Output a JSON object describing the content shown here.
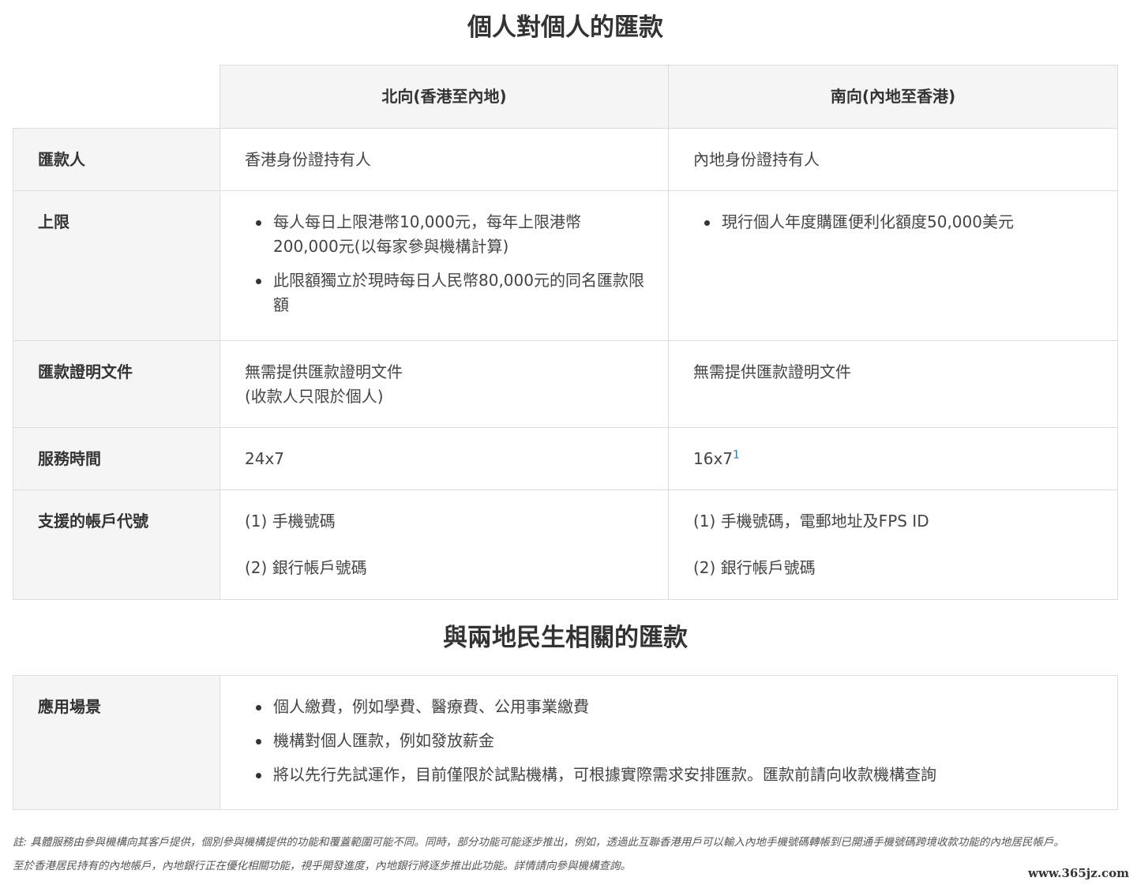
{
  "sections": {
    "p2p_title": "個人對個人的匯款",
    "livelihood_title": "與兩地民生相關的匯款"
  },
  "p2p_table": {
    "columns": [
      "北向(香港至內地)",
      "南向(內地至香港)"
    ],
    "rows": {
      "remitter": {
        "label": "匯款人",
        "north": "香港身份證持有人",
        "south": "內地身份證持有人"
      },
      "limit": {
        "label": "上限",
        "north": [
          "每人每日上限港幣10,000元，每年上限港幣200,000元(以每家參與機構計算)",
          "此限額獨立於現時每日人民幣80,000元的同名匯款限額"
        ],
        "south": [
          "現行個人年度購匯便利化額度50,000美元"
        ]
      },
      "documents": {
        "label": "匯款證明文件",
        "north_line1": "無需提供匯款證明文件",
        "north_line2": "(收款人只限於個人)",
        "south": "無需提供匯款證明文件"
      },
      "service_hours": {
        "label": "服務時間",
        "north": "24x7",
        "south": "16x7",
        "south_footnote": "1"
      },
      "account_ids": {
        "label": "支援的帳戶代號",
        "north_line1": "(1) 手機號碼",
        "north_line2": "(2) 銀行帳戶號碼",
        "south_line1": "(1) 手機號碼，電郵地址及FPS ID",
        "south_line2": "(2) 銀行帳戶號碼"
      }
    }
  },
  "livelihood_table": {
    "label": "應用場景",
    "items": [
      "個人繳費，例如學費、醫療費、公用事業繳費",
      "機構對個人匯款，例如發放薪金",
      "將以先行先試運作，目前僅限於試點機構，可根據實際需求安排匯款。匯款前請向收款機構查詢"
    ]
  },
  "footnote": {
    "line1": "註: 具體服務由參與機構向其客戶提供，個別參與機構提供的功能和覆蓋範圍可能不同。同時，部分功能可能逐步推出，例如，透過此互聯香港用戶可以輸入內地手機號碼轉帳到已開通手機號碼跨境收款功能的內地居民帳戶。",
    "line2": "至於香港居民持有的內地帳戶，內地銀行正在優化相關功能，視乎開發進度，內地銀行將逐步推出此功能。詳情請向參與機構查詢。"
  },
  "watermark": "www.365jz.com"
}
